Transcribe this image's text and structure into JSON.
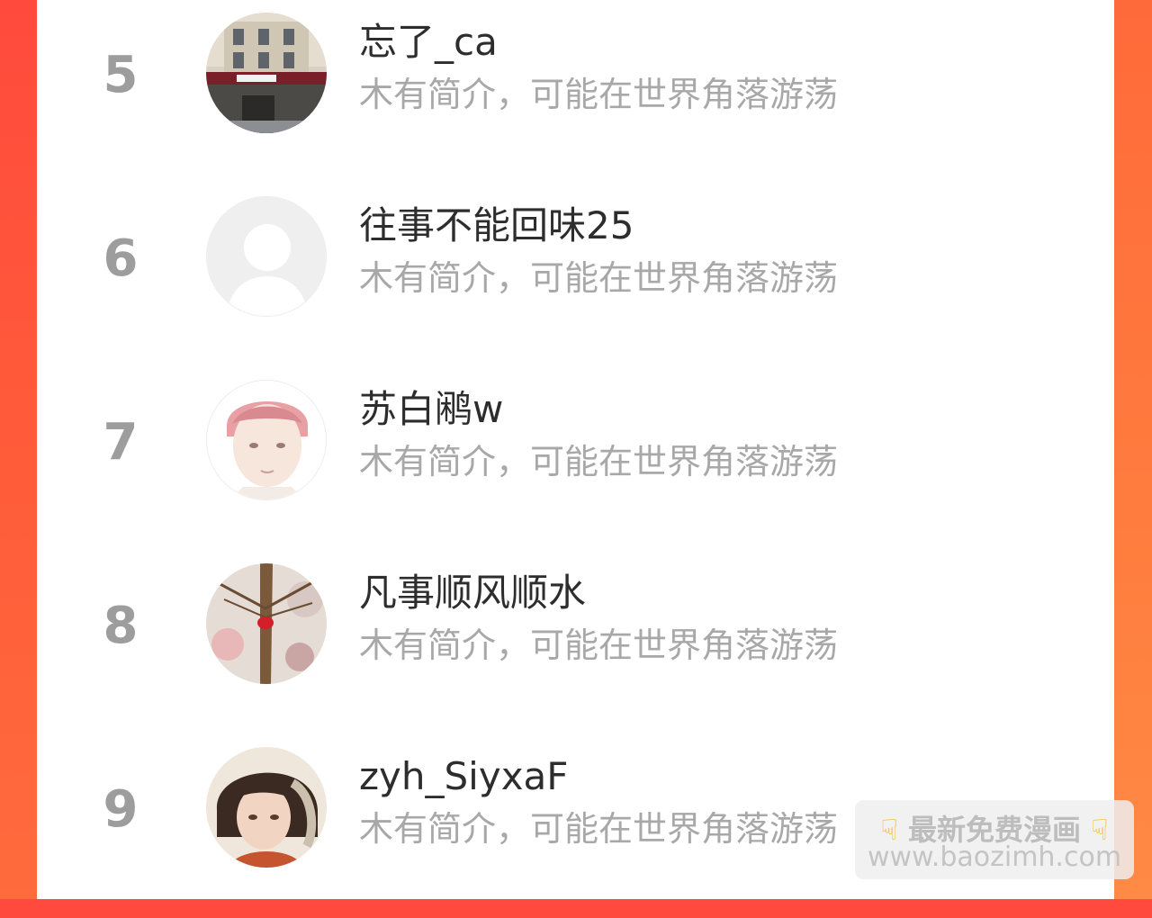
{
  "ranking": [
    {
      "rank": "5",
      "name": "忘了_ca",
      "bio": "木有简介，可能在世界角落游荡",
      "avatar": "building-photo-avatar"
    },
    {
      "rank": "6",
      "name": "往事不能回味25",
      "bio": "木有简介，可能在世界角落游荡",
      "avatar": "default-user-avatar"
    },
    {
      "rank": "7",
      "name": "苏白鹇w",
      "bio": "木有简介，可能在世界角落游荡",
      "avatar": "anime-boy-avatar"
    },
    {
      "rank": "8",
      "name": "凡事顺风顺水",
      "bio": "木有简介，可能在世界角落游荡",
      "avatar": "branch-photo-avatar"
    },
    {
      "rank": "9",
      "name": "zyh_SiyxaF",
      "bio": "木有简介，可能在世界角落游荡",
      "avatar": "anime-man-avatar"
    }
  ],
  "watermark": {
    "title": "最新免费漫画",
    "url": "www.baozimh.com",
    "hand_icon": "pointing-down-icon"
  },
  "colors": {
    "accent_left": "#ff4a3d",
    "accent_right": "#ff7d3e",
    "rank_text": "#9d9d9d",
    "name_text": "#2d2d2d",
    "bio_text": "#a8a8a8"
  }
}
